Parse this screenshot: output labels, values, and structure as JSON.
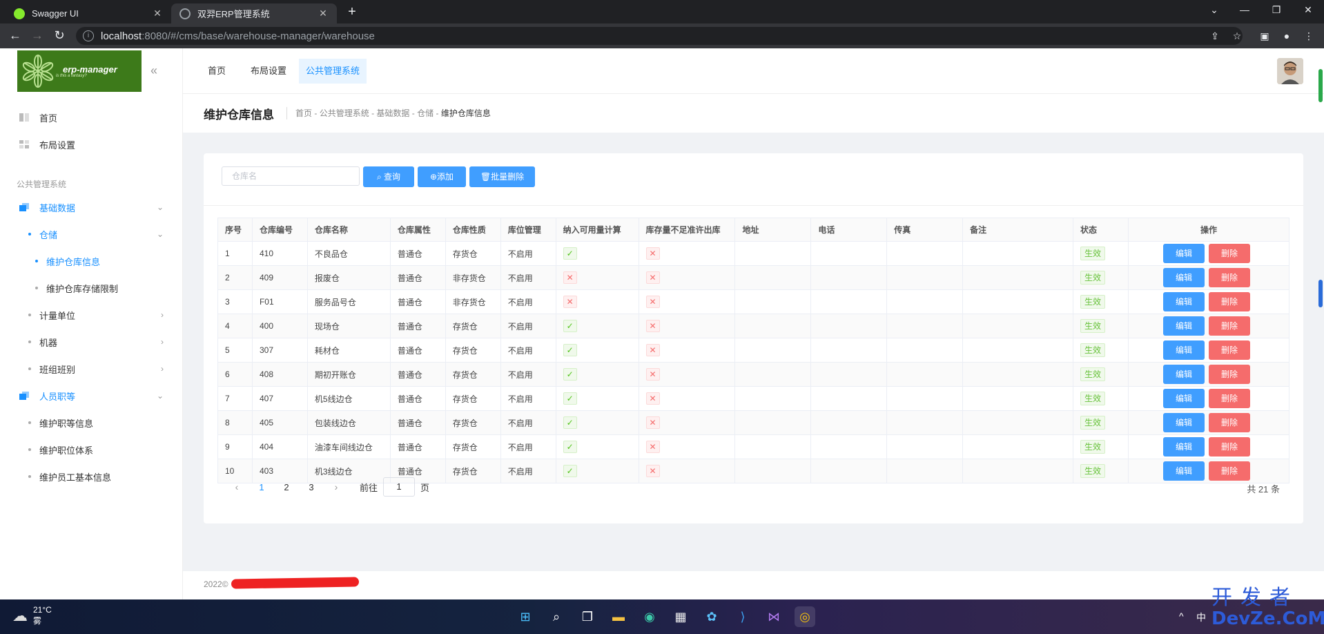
{
  "browser": {
    "tabs": [
      {
        "title": "Swagger UI",
        "favicon_color": "#85ea2d"
      },
      {
        "title": "双羿ERP管理系统",
        "favicon_color": "#9aa0a6"
      }
    ],
    "url_host": "localhost",
    "url_path": ":8080/#/cms/base/warehouse-manager/warehouse"
  },
  "sidebar": {
    "logo_text": "erp-manager",
    "logo_sub": "is this a fantasy?",
    "top_items": [
      {
        "label": "首页"
      },
      {
        "label": "布局设置"
      }
    ],
    "group_title": "公共管理系统",
    "base_data": "基础数据",
    "warehouse": "仓储",
    "warehouse_children": [
      "维护仓库信息",
      "维护仓库存储限制"
    ],
    "base_children": [
      "计量单位",
      "机器",
      "班组班别"
    ],
    "hr": "人员职等",
    "hr_children": [
      "维护职等信息",
      "维护职位体系",
      "维护员工基本信息"
    ]
  },
  "topnav": {
    "tabs": [
      "首页",
      "布局设置",
      "公共管理系统"
    ]
  },
  "page": {
    "title": "维护仓库信息",
    "breadcrumb": [
      "首页",
      "公共管理系统",
      "基础数据",
      "仓储",
      "维护仓库信息"
    ]
  },
  "toolbar": {
    "search_placeholder": "仓库名",
    "query": "查询",
    "add": "添加",
    "batch_delete": "批量删除"
  },
  "table": {
    "columns": [
      "序号",
      "仓库编号",
      "仓库名称",
      "仓库属性",
      "仓库性质",
      "库位管理",
      "纳入可用量计算",
      "库存量不足准许出库",
      "地址",
      "电话",
      "传真",
      "备注",
      "状态",
      "操作"
    ],
    "rows": [
      {
        "no": "1",
        "code": "410",
        "name": "不良品仓",
        "attr": "普通仓",
        "nature": "存货仓",
        "loc": "不启用",
        "avail": true,
        "allow": false,
        "status": "生效"
      },
      {
        "no": "2",
        "code": "409",
        "name": "报废仓",
        "attr": "普通仓",
        "nature": "非存货仓",
        "loc": "不启用",
        "avail": false,
        "allow": false,
        "status": "生效"
      },
      {
        "no": "3",
        "code": "F01",
        "name": "服务品号仓",
        "attr": "普通仓",
        "nature": "非存货仓",
        "loc": "不启用",
        "avail": false,
        "allow": false,
        "status": "生效"
      },
      {
        "no": "4",
        "code": "400",
        "name": "现场仓",
        "attr": "普通仓",
        "nature": "存货仓",
        "loc": "不启用",
        "avail": true,
        "allow": false,
        "status": "生效"
      },
      {
        "no": "5",
        "code": "307",
        "name": "耗材仓",
        "attr": "普通仓",
        "nature": "存货仓",
        "loc": "不启用",
        "avail": true,
        "allow": false,
        "status": "生效"
      },
      {
        "no": "6",
        "code": "408",
        "name": "期初开账仓",
        "attr": "普通仓",
        "nature": "存货仓",
        "loc": "不启用",
        "avail": true,
        "allow": false,
        "status": "生效"
      },
      {
        "no": "7",
        "code": "407",
        "name": "机5线边仓",
        "attr": "普通仓",
        "nature": "存货仓",
        "loc": "不启用",
        "avail": true,
        "allow": false,
        "status": "生效"
      },
      {
        "no": "8",
        "code": "405",
        "name": "包装线边仓",
        "attr": "普通仓",
        "nature": "存货仓",
        "loc": "不启用",
        "avail": true,
        "allow": false,
        "status": "生效"
      },
      {
        "no": "9",
        "code": "404",
        "name": "油漆车间线边仓",
        "attr": "普通仓",
        "nature": "存货仓",
        "loc": "不启用",
        "avail": true,
        "allow": false,
        "status": "生效"
      },
      {
        "no": "10",
        "code": "403",
        "name": "机3线边仓",
        "attr": "普通仓",
        "nature": "存货仓",
        "loc": "不启用",
        "avail": true,
        "allow": false,
        "status": "生效"
      }
    ],
    "edit_label": "编辑",
    "delete_label": "删除"
  },
  "pagination": {
    "pages": [
      "1",
      "2",
      "3"
    ],
    "current": "1",
    "goto_prefix": "前往",
    "goto_value": "1",
    "goto_suffix": "页",
    "total": "共 21 条"
  },
  "footer": {
    "text": "2022©"
  },
  "taskbar": {
    "temperature": "21°C",
    "weather": "雾",
    "ime": "中"
  },
  "watermark": {
    "cn": "开发者",
    "en": "DevZe.CoM"
  }
}
